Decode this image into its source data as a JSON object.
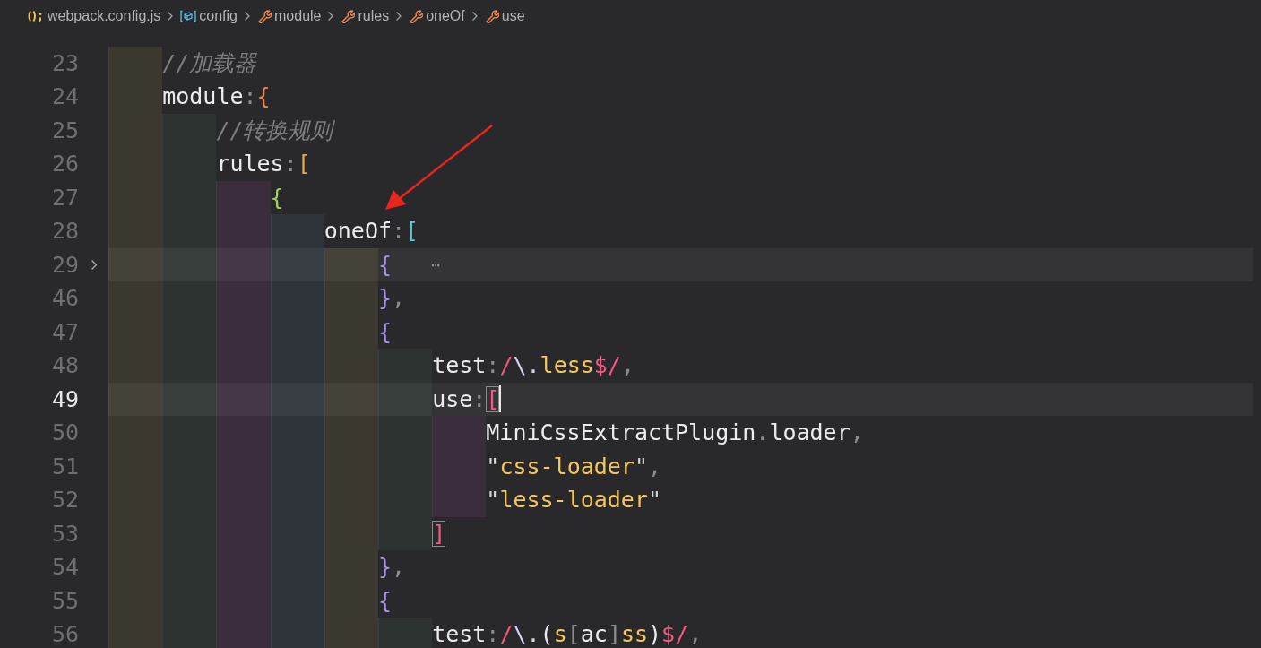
{
  "breadcrumb": [
    {
      "kind": "file",
      "label": "webpack.config.js"
    },
    {
      "kind": "variable",
      "label": "config"
    },
    {
      "kind": "field",
      "label": "module"
    },
    {
      "kind": "field",
      "label": "rules"
    },
    {
      "kind": "field",
      "label": "oneOf"
    },
    {
      "kind": "field",
      "label": "use"
    }
  ],
  "lines": [
    {
      "number": "23",
      "current": false,
      "folded": false,
      "tokens": [
        {
          "kind": "comment",
          "text": "    //加载器"
        }
      ]
    },
    {
      "number": "24",
      "current": false,
      "folded": false,
      "tokens": [
        {
          "kind": "name",
          "text": "    module"
        },
        {
          "kind": "punct",
          "text": ":"
        },
        {
          "kind": "brace1",
          "text": "{"
        }
      ]
    },
    {
      "number": "25",
      "current": false,
      "folded": false,
      "tokens": [
        {
          "kind": "comment",
          "text": "        //转换规则"
        }
      ]
    },
    {
      "number": "26",
      "current": false,
      "folded": false,
      "tokens": [
        {
          "kind": "name",
          "text": "        rules"
        },
        {
          "kind": "punct",
          "text": ":"
        },
        {
          "kind": "brace2",
          "text": "["
        }
      ]
    },
    {
      "number": "27",
      "current": false,
      "folded": false,
      "tokens": [
        {
          "kind": "brace3",
          "text": "            {"
        }
      ]
    },
    {
      "number": "28",
      "current": false,
      "folded": false,
      "tokens": [
        {
          "kind": "name",
          "text": "                oneOf"
        },
        {
          "kind": "punct",
          "text": ":"
        },
        {
          "kind": "brace4",
          "text": "["
        }
      ]
    },
    {
      "number": "29",
      "current": false,
      "folded": true,
      "placeholder": "⋯",
      "tokens": [
        {
          "kind": "brace5",
          "text": "                    {"
        }
      ]
    },
    {
      "number": "46",
      "current": false,
      "folded": false,
      "tokens": [
        {
          "kind": "brace5",
          "text": "                    }"
        },
        {
          "kind": "punct",
          "text": ","
        }
      ]
    },
    {
      "number": "47",
      "current": false,
      "folded": false,
      "tokens": [
        {
          "kind": "brace5",
          "text": "                    {"
        }
      ]
    },
    {
      "number": "48",
      "current": false,
      "folded": false,
      "tokens": [
        {
          "kind": "name",
          "text": "                        test"
        },
        {
          "kind": "punct",
          "text": ":"
        },
        {
          "kind": "regex-delim",
          "text": "/"
        },
        {
          "kind": "regex-escape",
          "text": "\\."
        },
        {
          "kind": "regex-text",
          "text": "less"
        },
        {
          "kind": "regex-delim",
          "text": "$/"
        },
        {
          "kind": "punct",
          "text": ","
        }
      ]
    },
    {
      "number": "49",
      "current": true,
      "folded": false,
      "tokens": [
        {
          "kind": "name",
          "text": "                        use"
        },
        {
          "kind": "punct",
          "text": ":"
        },
        {
          "kind": "brace6",
          "text": "[",
          "match": true
        }
      ]
    },
    {
      "number": "50",
      "current": false,
      "folded": false,
      "tokens": [
        {
          "kind": "name",
          "text": "                            MiniCssExtractPlugin"
        },
        {
          "kind": "punct",
          "text": "."
        },
        {
          "kind": "name",
          "text": "loader"
        },
        {
          "kind": "punct",
          "text": ","
        }
      ]
    },
    {
      "number": "51",
      "current": false,
      "folded": false,
      "tokens": [
        {
          "kind": "quote",
          "text": "                            \""
        },
        {
          "kind": "string",
          "text": "css-loader"
        },
        {
          "kind": "quote",
          "text": "\""
        },
        {
          "kind": "punct",
          "text": ","
        }
      ]
    },
    {
      "number": "52",
      "current": false,
      "folded": false,
      "tokens": [
        {
          "kind": "quote",
          "text": "                            \""
        },
        {
          "kind": "string",
          "text": "less-loader"
        },
        {
          "kind": "quote",
          "text": "\""
        }
      ]
    },
    {
      "number": "53",
      "current": false,
      "folded": false,
      "tokens": [
        {
          "kind": "brace6",
          "text": "                        ]",
          "match": true
        }
      ]
    },
    {
      "number": "54",
      "current": false,
      "folded": false,
      "tokens": [
        {
          "kind": "brace5",
          "text": "                    }"
        },
        {
          "kind": "punct",
          "text": ","
        }
      ]
    },
    {
      "number": "55",
      "current": false,
      "folded": false,
      "tokens": [
        {
          "kind": "brace5",
          "text": "                    {"
        }
      ]
    },
    {
      "number": "56",
      "current": false,
      "folded": false,
      "tokens": [
        {
          "kind": "name",
          "text": "                        test"
        },
        {
          "kind": "punct",
          "text": ":"
        },
        {
          "kind": "regex-delim",
          "text": "/"
        },
        {
          "kind": "regex-escape",
          "text": "\\."
        },
        {
          "kind": "name",
          "text": "("
        },
        {
          "kind": "regex-text",
          "text": "s"
        },
        {
          "kind": "punct",
          "text": "["
        },
        {
          "kind": "name",
          "text": "ac"
        },
        {
          "kind": "punct",
          "text": "]"
        },
        {
          "kind": "regex-text",
          "text": "ss"
        },
        {
          "kind": "name",
          "text": ")"
        },
        {
          "kind": "regex-delim",
          "text": "$/"
        },
        {
          "kind": "punct",
          "text": ","
        }
      ]
    }
  ]
}
